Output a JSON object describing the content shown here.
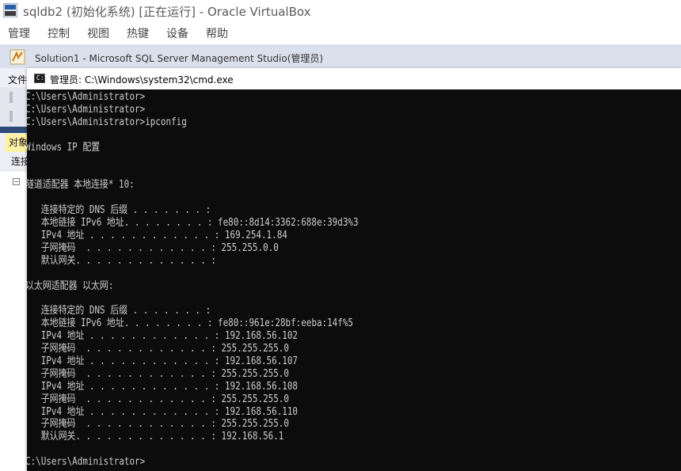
{
  "vbox": {
    "title": "sqldb2 (初始化系统) [正在运行] - Oracle VirtualBox",
    "menu": [
      "管理",
      "控制",
      "视图",
      "热键",
      "设备",
      "帮助"
    ]
  },
  "ssms": {
    "title": "Solution1 - Microsoft SQL Server Management Studio(管理员)",
    "file_menu": "文件",
    "object_explorer_tab": "对象",
    "connect_label": "连接"
  },
  "cmd": {
    "title": "管理员: C:\\Windows\\system32\\cmd.exe",
    "icon_glyph": "C:\\",
    "lines": [
      "C:\\Users\\Administrator>",
      "C:\\Users\\Administrator>",
      "C:\\Users\\Administrator>ipconfig",
      "",
      "Windows IP 配置",
      "",
      "",
      "隧道适配器 本地连接* 10:",
      "",
      "   连接特定的 DNS 后缀 . . . . . . . :",
      "   本地链接 IPv6 地址. . . . . . . . : fe80::8d14:3362:688e:39d3%3",
      "   IPv4 地址 . . . . . . . . . . . . : 169.254.1.84",
      "   子网掩码  . . . . . . . . . . . . : 255.255.0.0",
      "   默认网关. . . . . . . . . . . . . :",
      "",
      "以太网适配器 以太网:",
      "",
      "   连接特定的 DNS 后缀 . . . . . . . :",
      "   本地链接 IPv6 地址. . . . . . . . : fe80::961e:28bf:eeba:14f%5",
      "   IPv4 地址 . . . . . . . . . . . . : 192.168.56.102",
      "   子网掩码  . . . . . . . . . . . . : 255.255.255.0",
      "   IPv4 地址 . . . . . . . . . . . . : 192.168.56.107",
      "   子网掩码  . . . . . . . . . . . . : 255.255.255.0",
      "   IPv4 地址 . . . . . . . . . . . . : 192.168.56.108",
      "   子网掩码  . . . . . . . . . . . . : 255.255.255.0",
      "   IPv4 地址 . . . . . . . . . . . . : 192.168.56.110",
      "   子网掩码  . . . . . . . . . . . . : 255.255.255.0",
      "   默认网关. . . . . . . . . . . . . : 192.168.56.1",
      "",
      "C:\\Users\\Administrator>"
    ]
  },
  "colors": {
    "console_bg": "#0c0c0c",
    "console_fg": "#cccccc",
    "ssms_titlebar": "#dbe1ec",
    "object_tab_highlight": "#fff2a6"
  },
  "icons": {
    "vbox_logo": "virtualbox-logo-icon",
    "ssms_icon": "ssms-icon",
    "cmd_icon": "cmd-icon"
  }
}
